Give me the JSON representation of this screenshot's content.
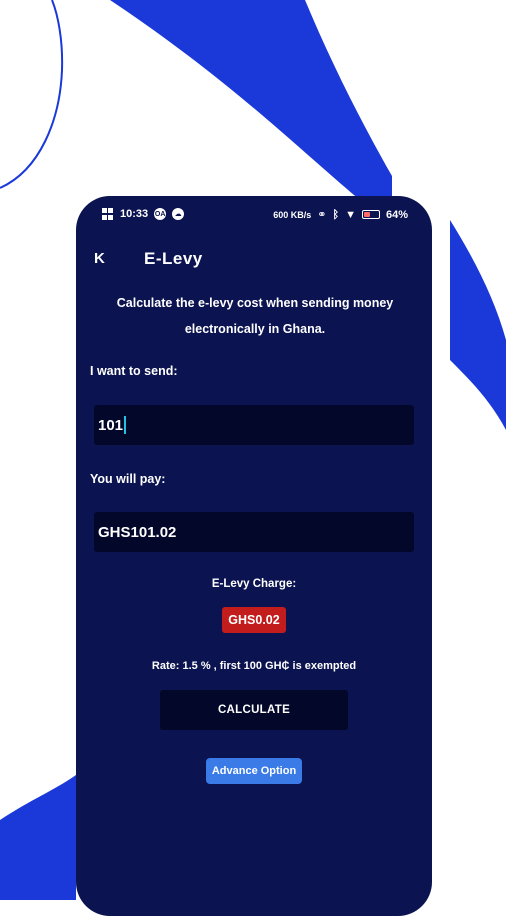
{
  "status_bar": {
    "time": "10:33",
    "icon_1": "OA",
    "speed": "600 KB/s",
    "battery": "64%"
  },
  "app_bar": {
    "back_icon": "K",
    "title": "E-Levy"
  },
  "subtitle": "Calculate the e-levy cost when sending money electronically in Ghana.",
  "send": {
    "label": "I want to send:",
    "value": "101"
  },
  "pay": {
    "label": "You will pay:",
    "value": "GHS101.02"
  },
  "charge": {
    "label": "E-Levy Charge:",
    "value": "GHS0.02"
  },
  "rate_text": "Rate: 1.5 % , first 100 GH₵ is exempted",
  "calculate_label": "CALCULATE",
  "advance_label": "Advance Option",
  "colors": {
    "phone_bg": "#0b1350",
    "field_bg": "#03072a",
    "badge_red": "#c21c1c",
    "accent_blue": "#3b7be8",
    "shape_blue": "#1a39d8"
  }
}
